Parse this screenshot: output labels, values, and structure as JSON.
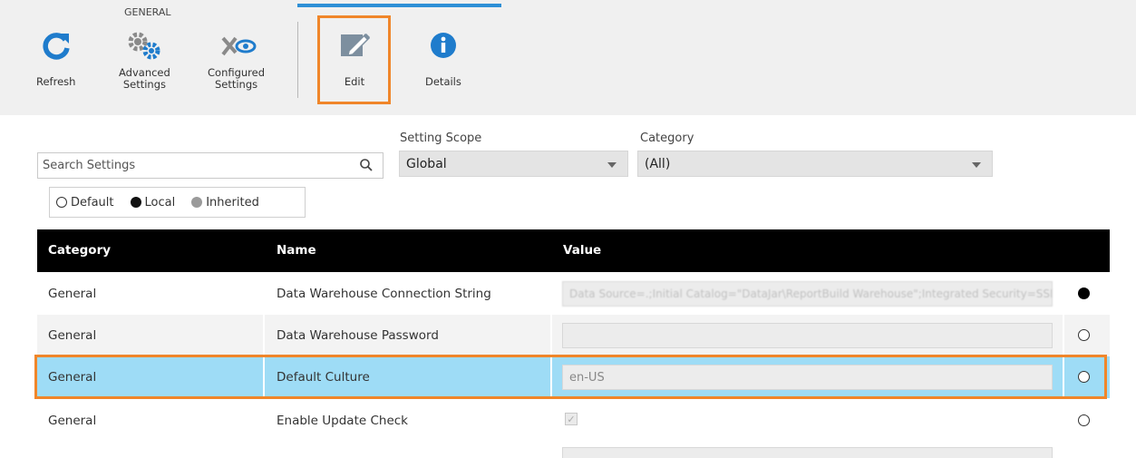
{
  "ribbon": {
    "group_label": "GENERAL",
    "buttons": {
      "refresh": "Refresh",
      "advanced_1": "Advanced",
      "advanced_2": "Settings",
      "configured_1": "Configured",
      "configured_2": "Settings",
      "edit": "Edit",
      "details": "Details"
    },
    "icons": {
      "refresh": "refresh-icon",
      "advanced": "gears-icon",
      "configured": "tools-eye-icon",
      "edit": "pencil-icon",
      "details": "info-icon"
    }
  },
  "filters": {
    "search_placeholder": "Search Settings",
    "scope_label": "Setting Scope",
    "scope_value": "Global",
    "category_label": "Category",
    "category_value": "(All)"
  },
  "legend": {
    "default": "Default",
    "local": "Local",
    "inherited": "Inherited"
  },
  "table": {
    "headers": {
      "category": "Category",
      "name": "Name",
      "value": "Value"
    },
    "rows": [
      {
        "category": "General",
        "name": "Data Warehouse Connection String",
        "value": "Data Source=.;Initial Catalog=\"DataJar\\ReportBuild Warehouse\";Integrated Security=SSPI",
        "state": "local"
      },
      {
        "category": "General",
        "name": "Data Warehouse Password",
        "value": "",
        "state": "default"
      },
      {
        "category": "General",
        "name": "Default Culture",
        "value": "en-US",
        "state": "default"
      },
      {
        "category": "General",
        "name": "Enable Update Check",
        "value": "✓",
        "state": "default"
      }
    ]
  },
  "colors": {
    "accent": "#2e8fd6",
    "highlight": "#f0862a",
    "selected_row": "#9edcf6",
    "header": "#000000"
  }
}
